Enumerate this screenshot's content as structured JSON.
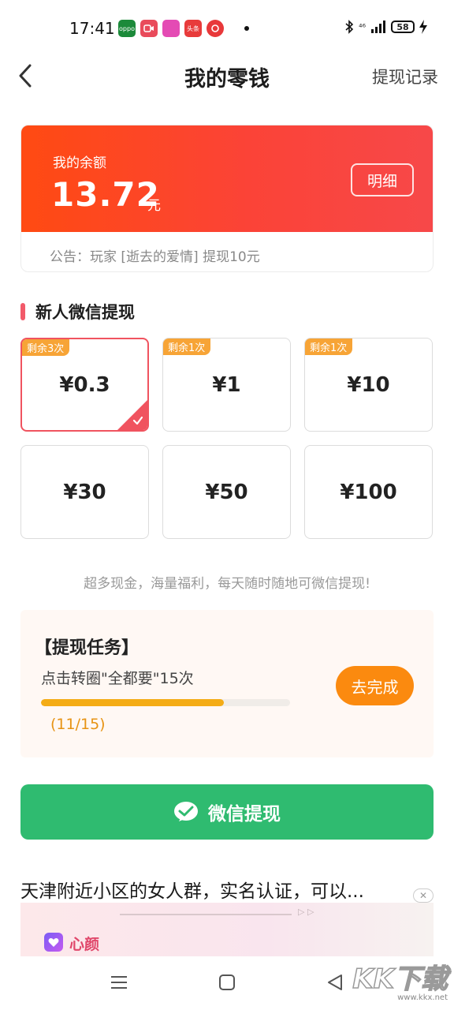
{
  "status_bar": {
    "time": "17:41",
    "network": "⁴⁶",
    "battery": "58",
    "apps": [
      {
        "icon": "oppo-app-icon",
        "color": "#1c8a3a",
        "text": "oppo"
      },
      {
        "icon": "video-call-app-icon",
        "color": "#e94b5b",
        "text": ""
      },
      {
        "icon": "shopping-app-icon",
        "color": "#e44bb4",
        "text": ""
      },
      {
        "icon": "toutiao-app-icon",
        "color": "#e83b3b",
        "text": "头条"
      },
      {
        "icon": "netease-music-app-icon",
        "color": "#e8383a",
        "text": ""
      }
    ]
  },
  "header": {
    "title": "我的零钱",
    "history_link": "提现记录"
  },
  "balance": {
    "label": "我的余额",
    "amount": "13.72",
    "unit": "元",
    "detail_button": "明细",
    "notice": "公告：玩家 [逝去的爱情] 提现10元"
  },
  "section": {
    "title": "新人微信提现"
  },
  "options": [
    {
      "amount": "¥0.3",
      "badge": "剩余3次",
      "selected": true
    },
    {
      "amount": "¥1",
      "badge": "剩余1次",
      "selected": false
    },
    {
      "amount": "¥10",
      "badge": "剩余1次",
      "selected": false
    },
    {
      "amount": "¥30",
      "badge": "",
      "selected": false
    },
    {
      "amount": "¥50",
      "badge": "",
      "selected": false
    },
    {
      "amount": "¥100",
      "badge": "",
      "selected": false
    }
  ],
  "promo_text": "超多现金，海量福利，每天随时随地可微信提现!",
  "task": {
    "title": "【提现任务】",
    "description": "点击转圈\"全都要\"15次",
    "progress_text": "(11/15)",
    "progress_fraction": 0.733,
    "button": "去完成"
  },
  "withdraw_button": "微信提现",
  "ad": {
    "title": "天津附近小区的女人群，实名认证，可以...",
    "brand": "心颜",
    "close": "✕"
  },
  "watermark": {
    "logo": "KK下载",
    "url": "www.kkx.net"
  },
  "colors": {
    "accent_red": "#f74849",
    "accent_orange": "#fb8a0f",
    "wechat_green": "#2fbb70",
    "badge_orange": "#f7a436"
  }
}
